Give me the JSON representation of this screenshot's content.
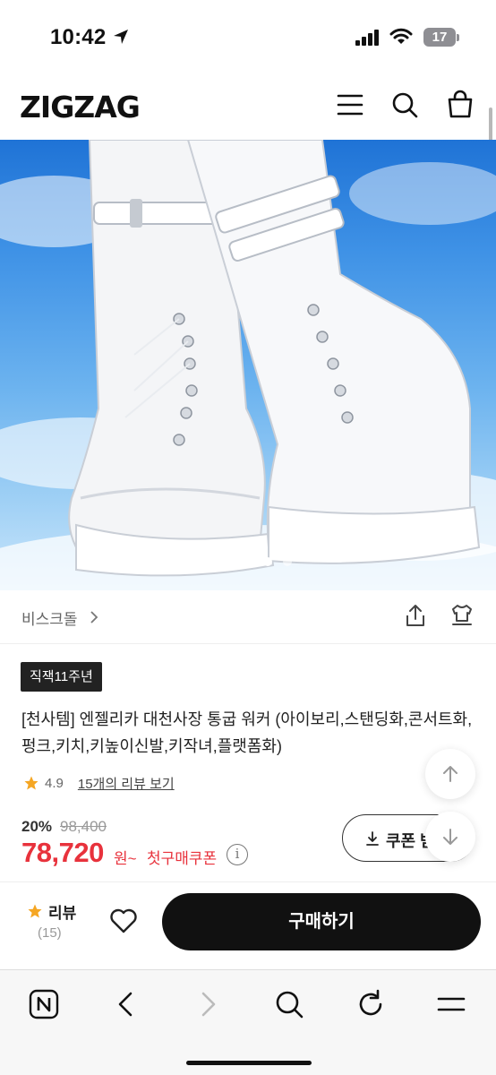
{
  "status_bar": {
    "time": "10:42",
    "battery": "17"
  },
  "header": {
    "logo": "ZIGZAG"
  },
  "hero": {
    "slide_count": 5,
    "active_slide": 4
  },
  "brand": {
    "name": "비스크돌",
    "chevron": ">"
  },
  "product": {
    "badge": "직잭11주년",
    "title": "[천사템] 엔젤리카 대천사장 통굽 워커 (아이보리,스탠딩화,콘서트화,펑크,키치,키높이신발,키작녀,플랫폼화)",
    "rating": "4.9",
    "reviews_link": "15개의 리뷰 보기",
    "discount": "20%",
    "original_price": "98,400",
    "price": "78,720",
    "price_unit": "원~",
    "price_note": "첫구매쿠폰",
    "info_icon": "i",
    "coupon_button": "쿠폰 받기"
  },
  "buy_bar": {
    "review_label": "리뷰",
    "review_count": "(15)",
    "buy_button": "구매하기"
  },
  "colors": {
    "accent_red": "#e8323c",
    "dark": "#111111",
    "star": "#f5a623"
  },
  "icons": [
    "location-arrow-icon",
    "signal-icon",
    "wifi-icon",
    "menu-icon",
    "search-icon",
    "shopping-bag-icon",
    "chevron-right-icon",
    "share-icon",
    "outfit-icon",
    "star-icon",
    "scroll-up-icon",
    "scroll-down-icon",
    "download-icon",
    "heart-icon",
    "naver-home-icon",
    "back-icon",
    "forward-icon",
    "refresh-icon"
  ]
}
